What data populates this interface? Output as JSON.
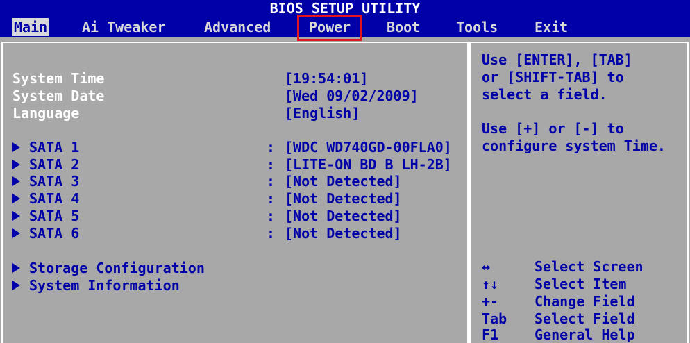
{
  "title": "BIOS SETUP UTILITY",
  "menu": {
    "main": "Main",
    "ai_tweaker": "Ai Tweaker",
    "advanced": "Advanced",
    "power": "Power",
    "boot": "Boot",
    "tools": "Tools",
    "exit": "Exit"
  },
  "settings": {
    "system_time": {
      "label": "System Time",
      "value": "[19:54:01]"
    },
    "system_date": {
      "label": "System Date",
      "value": "[Wed 09/02/2009]"
    },
    "language": {
      "label": "Language",
      "value": "[English]"
    }
  },
  "sata": [
    {
      "label": "SATA 1",
      "value": "[WDC WD740GD-00FLA0]"
    },
    {
      "label": "SATA 2",
      "value": "[LITE-ON BD B LH-2B]"
    },
    {
      "label": "SATA 3",
      "value": "[Not Detected]"
    },
    {
      "label": "SATA 4",
      "value": "[Not Detected]"
    },
    {
      "label": "SATA 5",
      "value": "[Not Detected]"
    },
    {
      "label": "SATA 6",
      "value": "[Not Detected]"
    }
  ],
  "separator": ":",
  "submenus": {
    "storage": "Storage Configuration",
    "system_info": "System Information"
  },
  "help": {
    "line1": "Use [ENTER], [TAB]",
    "line2": "or [SHIFT-TAB] to",
    "line3": "select a field.",
    "line4": "Use [+] or [-] to",
    "line5": "configure system Time."
  },
  "keys": [
    {
      "key": "↔",
      "desc": "Select Screen"
    },
    {
      "key": "↑↓",
      "desc": "Select Item"
    },
    {
      "key": "+-",
      "desc": "Change Field"
    },
    {
      "key": "Tab",
      "desc": "Select Field"
    },
    {
      "key": "F1",
      "desc": "General Help"
    }
  ],
  "colors": {
    "background": "#a8a8a8",
    "header_blue": "#0000a8",
    "highlight_red": "#e4141e",
    "label_white": "#ffffff"
  }
}
